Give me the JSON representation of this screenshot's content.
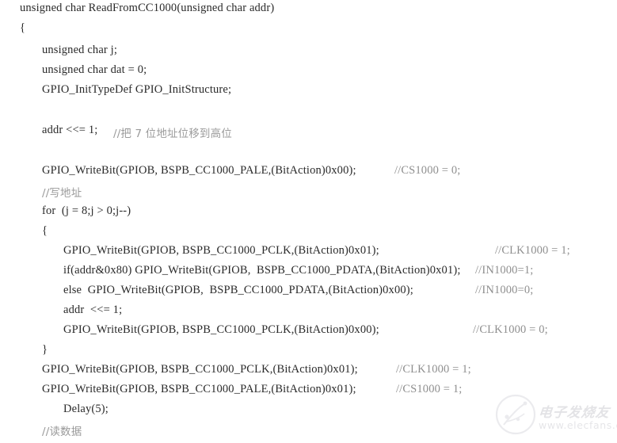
{
  "document": {
    "type": "source-code-listing",
    "language": "C",
    "background_color": "#ffffff",
    "code_color": "#2a2a2a",
    "comment_color": "#8f8f8f"
  },
  "code_lines": [
    {
      "id": "l1",
      "indent": 25,
      "text": "unsigned char ReadFromCC1000(unsigned char addr)"
    },
    {
      "id": "l2",
      "indent": 25,
      "text": "{"
    },
    {
      "id": "l3",
      "indent": 53,
      "text": "unsigned char j;"
    },
    {
      "id": "l4",
      "indent": 53,
      "text": "unsigned char dat = 0;"
    },
    {
      "id": "l5",
      "indent": 53,
      "text": "GPIO_InitTypeDef GPIO_InitStructure;"
    },
    {
      "id": "l6",
      "indent": 53,
      "text": "addr <<= 1;"
    },
    {
      "id": "l7",
      "indent": 53,
      "text": "GPIO_WriteBit(GPIOB, BSPB_CC1000_PALE,(BitAction)0x00);"
    },
    {
      "id": "l8",
      "indent": 53,
      "text": "for  (j = 8;j > 0;j--)"
    },
    {
      "id": "l9",
      "indent": 53,
      "text": "{"
    },
    {
      "id": "l10",
      "indent": 80,
      "text": "GPIO_WriteBit(GPIOB, BSPB_CC1000_PCLK,(BitAction)0x01);"
    },
    {
      "id": "l11",
      "indent": 80,
      "text": "if(addr&0x80) GPIO_WriteBit(GPIOB,  BSPB_CC1000_PDATA,(BitAction)0x01);"
    },
    {
      "id": "l12",
      "indent": 80,
      "text": "else  GPIO_WriteBit(GPIOB,  BSPB_CC1000_PDATA,(BitAction)0x00);"
    },
    {
      "id": "l13",
      "indent": 80,
      "text": "addr  <<= 1;"
    },
    {
      "id": "l14",
      "indent": 80,
      "text": "GPIO_WriteBit(GPIOB, BSPB_CC1000_PCLK,(BitAction)0x00);"
    },
    {
      "id": "l15",
      "indent": 53,
      "text": "}"
    },
    {
      "id": "l16",
      "indent": 53,
      "text": "GPIO_WriteBit(GPIOB, BSPB_CC1000_PCLK,(BitAction)0x01);"
    },
    {
      "id": "l17",
      "indent": 53,
      "text": "GPIO_WriteBit(GPIOB, BSPB_CC1000_PALE,(BitAction)0x01);"
    },
    {
      "id": "l18",
      "indent": 80,
      "text": "Delay(5);"
    }
  ],
  "comments": [
    {
      "id": "c1",
      "text": "//把 7 位地址位移到高位",
      "cjk": true
    },
    {
      "id": "c2",
      "text": "//CS1000 = 0;",
      "cjk": false
    },
    {
      "id": "c3",
      "text": "//写地址",
      "cjk": true
    },
    {
      "id": "c4",
      "text": "//CLK1000 = 1;",
      "cjk": false
    },
    {
      "id": "c5",
      "text": "//IN1000=1;",
      "cjk": false
    },
    {
      "id": "c6",
      "text": "//IN1000=0;",
      "cjk": false
    },
    {
      "id": "c7",
      "text": "//CLK1000 = 0;",
      "cjk": false
    },
    {
      "id": "c8",
      "text": "//CLK1000 = 1;",
      "cjk": false
    },
    {
      "id": "c9",
      "text": "//CS1000 = 1;",
      "cjk": false
    },
    {
      "id": "c10",
      "text": "//读数据",
      "cjk": true
    }
  ],
  "watermark": {
    "brand_cn": "电子发烧友",
    "url": "www.elecfans.com",
    "color": "#c9c9cf"
  }
}
